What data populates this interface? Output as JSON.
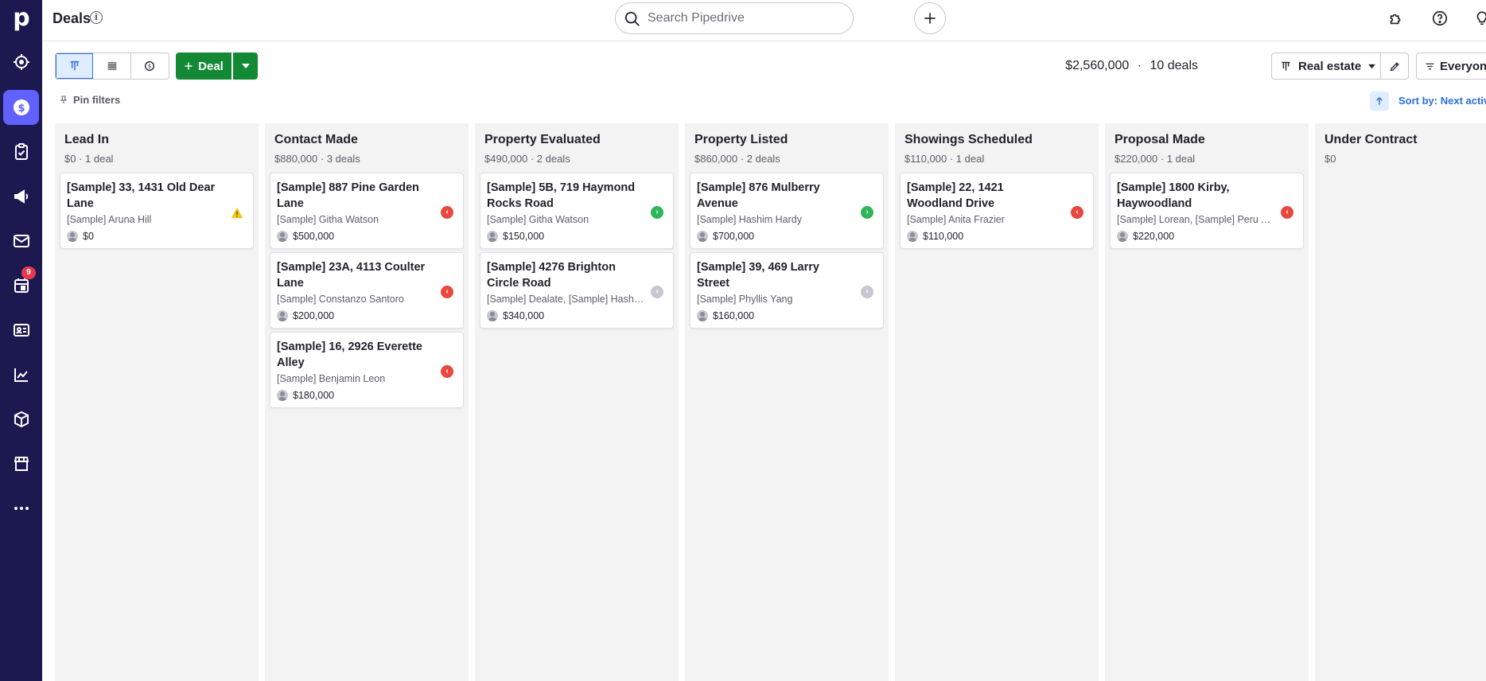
{
  "app": {
    "brand_letter": "p"
  },
  "header": {
    "title": "Deals",
    "info_icon": "info-icon",
    "search_placeholder": "Search Pipedrive"
  },
  "nav": {
    "items": [
      {
        "name": "focus",
        "icon": "target-icon"
      },
      {
        "name": "deals",
        "icon": "dollar-icon",
        "active": true
      },
      {
        "name": "activities",
        "icon": "clipboard-check-icon"
      },
      {
        "name": "campaigns",
        "icon": "megaphone-icon"
      },
      {
        "name": "mail",
        "icon": "mail-icon"
      },
      {
        "name": "calendar",
        "icon": "calendar-icon",
        "badge": "9"
      },
      {
        "name": "contacts",
        "icon": "contact-card-icon"
      },
      {
        "name": "insights",
        "icon": "chart-line-icon"
      },
      {
        "name": "products",
        "icon": "box-icon"
      },
      {
        "name": "marketplace",
        "icon": "store-icon"
      },
      {
        "name": "more",
        "icon": "more-icon"
      }
    ]
  },
  "toolbar": {
    "add_deal_label": "Deal",
    "summary_amount": "$2,560,000",
    "summary_sep": "·",
    "summary_count": "10 deals",
    "pipeline": "Real estate",
    "owner": "Everyone",
    "pin_filters": "Pin filters",
    "sort_label": "Sort by: Next activity"
  },
  "colors": {
    "rail": "#1b1950",
    "accent": "#6161ff",
    "primary_button": "#138936",
    "link": "#2c6de0"
  },
  "stages": [
    {
      "name": "Lead In",
      "meta": "$0 · 1 deal",
      "deals": [
        {
          "title": "[Sample] 33, 1431 Old Dear Lane",
          "person": "[Sample] Aruna Hill",
          "value": "$0",
          "status": "warning"
        }
      ]
    },
    {
      "name": "Contact Made",
      "meta": "$880,000 · 3 deals",
      "deals": [
        {
          "title": "[Sample] 887 Pine Garden Lane",
          "person": "[Sample] Githa Watson",
          "value": "$500,000",
          "status": "overdue"
        },
        {
          "title": "[Sample] 23A, 4113 Coulter Lane",
          "person": "[Sample] Constanzo Santoro",
          "value": "$200,000",
          "status": "overdue"
        },
        {
          "title": "[Sample] 16, 2926 Everette Alley",
          "person": "[Sample] Benjamin Leon",
          "value": "$180,000",
          "status": "overdue"
        }
      ]
    },
    {
      "name": "Property Evaluated",
      "meta": "$490,000 · 2 deals",
      "deals": [
        {
          "title": "[Sample] 5B, 719 Haymond Rocks Road",
          "person": "[Sample] Githa Watson",
          "value": "$150,000",
          "status": "planned"
        },
        {
          "title": "[Sample] 4276 Brighton Circle Road",
          "person": "[Sample] Dealate, [Sample] Hashim Hardy",
          "value": "$340,000",
          "status": "none"
        }
      ]
    },
    {
      "name": "Property Listed",
      "meta": "$860,000 · 2 deals",
      "deals": [
        {
          "title": "[Sample] 876 Mulberry Avenue",
          "person": "[Sample] Hashim Hardy",
          "value": "$700,000",
          "status": "planned"
        },
        {
          "title": "[Sample] 39, 469 Larry Street",
          "person": "[Sample] Phyllis Yang",
          "value": "$160,000",
          "status": "none"
        }
      ]
    },
    {
      "name": "Showings Scheduled",
      "meta": "$110,000 · 1 deal",
      "deals": [
        {
          "title": "[Sample] 22, 1421 Woodland Drive",
          "person": "[Sample] Anita Frazier",
          "value": "$110,000",
          "status": "overdue"
        }
      ]
    },
    {
      "name": "Proposal Made",
      "meta": "$220,000 · 1 deal",
      "deals": [
        {
          "title": "[Sample] 1800 Kirby, Haywoodland",
          "person": "[Sample] Lorean, [Sample] Peru Agency",
          "value": "$220,000",
          "status": "overdue"
        }
      ]
    },
    {
      "name": "Under Contract",
      "meta": "$0",
      "deals": []
    }
  ]
}
